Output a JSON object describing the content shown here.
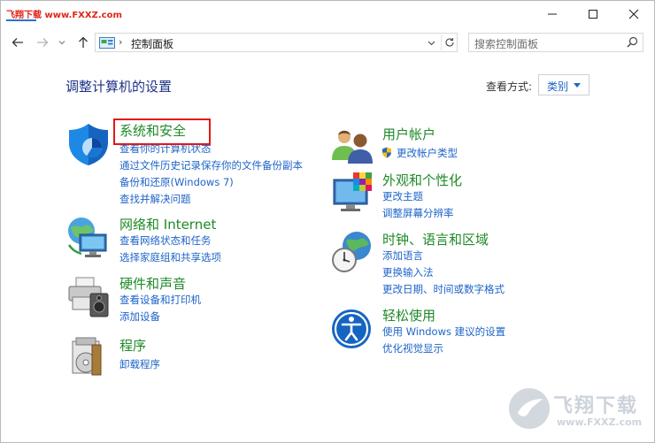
{
  "titlebar": {
    "brand": "飞翔下载 www.FXXZ.com"
  },
  "address": {
    "path": "控制面板",
    "separator": "›"
  },
  "search": {
    "placeholder": "搜索控制面板"
  },
  "header": {
    "title": "调整计算机的设置",
    "view_by_label": "查看方式:",
    "view_by_value": "类别"
  },
  "categories": {
    "system_security": {
      "title": "系统和安全",
      "links": [
        "查看你的计算机状态",
        "通过文件历史记录保存你的文件备份副本",
        "备份和还原(Windows 7)",
        "查找并解决问题"
      ]
    },
    "network": {
      "title": "网络和 Internet",
      "links": [
        "查看网络状态和任务",
        "选择家庭组和共享选项"
      ]
    },
    "hardware": {
      "title": "硬件和声音",
      "links": [
        "查看设备和打印机",
        "添加设备"
      ]
    },
    "programs": {
      "title": "程序",
      "links": [
        "卸载程序"
      ]
    },
    "user_accounts": {
      "title": "用户帐户",
      "links": [
        "更改帐户类型"
      ]
    },
    "appearance": {
      "title": "外观和个性化",
      "links": [
        "更改主题",
        "调整屏幕分辨率"
      ]
    },
    "clock": {
      "title": "时钟、语言和区域",
      "links": [
        "添加语言",
        "更换输入法",
        "更改日期、时间或数字格式"
      ]
    },
    "ease": {
      "title": "轻松使用",
      "links": [
        "使用 Windows 建议的设置",
        "优化视觉显示"
      ]
    }
  },
  "watermark": {
    "text": "飞翔下载",
    "url": "www.FXXZ.com"
  },
  "colors": {
    "heading": "#1e3287",
    "category_title": "#1e8a28",
    "link": "#1e64c8",
    "highlight": "#e01818"
  }
}
